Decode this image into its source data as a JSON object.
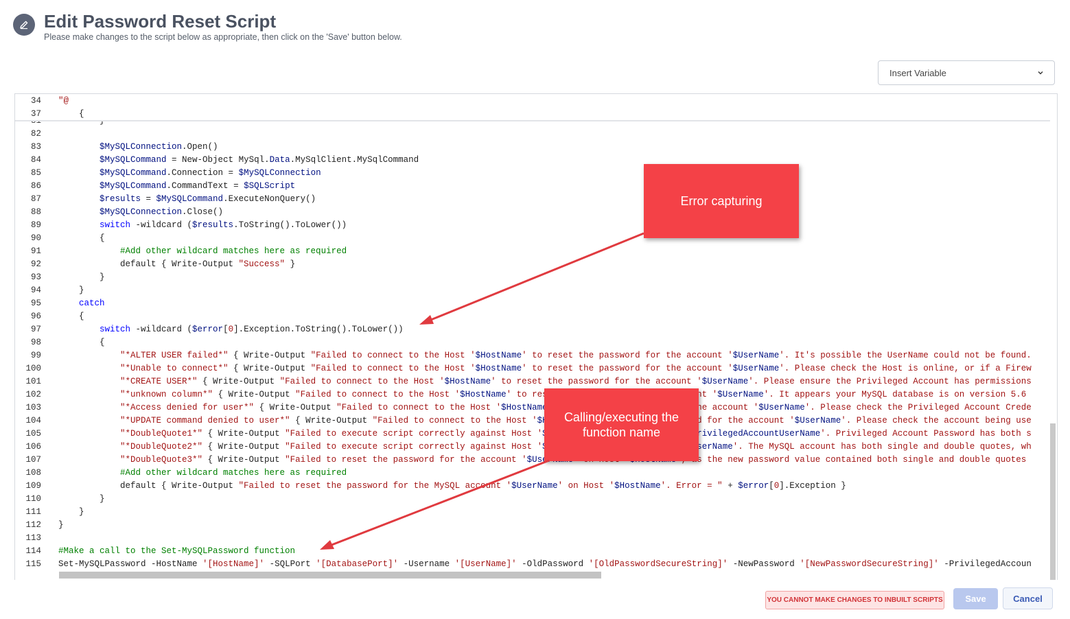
{
  "header": {
    "title": "Edit Password Reset Script",
    "subtitle": "Please make changes to the script below as appropriate, then click on the 'Save' button below.",
    "icon": "pencil-icon"
  },
  "insert_variable": {
    "label": "Insert Variable",
    "icon": "chevron-down-icon"
  },
  "editor": {
    "sticky_lines": [
      {
        "num": "34",
        "html": "<span class=\"s\">\"@</span>"
      },
      {
        "num": "37",
        "html": "    {"
      }
    ],
    "lines": [
      {
        "num": "81",
        "html": "        }"
      },
      {
        "num": "82",
        "html": ""
      },
      {
        "num": "83",
        "html": "        <span class=\"v\">$MySQLConnection</span>.Open()"
      },
      {
        "num": "84",
        "html": "        <span class=\"v\">$MySQLCommand</span> = New-Object MySql.<span class=\"v\">Data</span>.MySqlClient.MySqlCommand"
      },
      {
        "num": "85",
        "html": "        <span class=\"v\">$MySQLCommand</span>.Connection = <span class=\"v\">$MySQLConnection</span>"
      },
      {
        "num": "86",
        "html": "        <span class=\"v\">$MySQLCommand</span>.CommandText = <span class=\"v\">$SQLScript</span>"
      },
      {
        "num": "87",
        "html": "        <span class=\"v\">$results</span> = <span class=\"v\">$MySQLCommand</span>.ExecuteNonQuery()"
      },
      {
        "num": "88",
        "html": "        <span class=\"v\">$MySQLConnection</span>.Close()"
      },
      {
        "num": "89",
        "html": "        <span class=\"k\">switch</span> -wildcard (<span class=\"v\">$results</span>.ToString().ToLower())"
      },
      {
        "num": "90",
        "html": "        {"
      },
      {
        "num": "91",
        "html": "            <span class=\"c\">#Add other wildcard matches here as required</span>"
      },
      {
        "num": "92",
        "html": "            default { Write-Output <span class=\"s\">\"Success\"</span> }"
      },
      {
        "num": "93",
        "html": "        }"
      },
      {
        "num": "94",
        "html": "    }"
      },
      {
        "num": "95",
        "html": "    <span class=\"k\">catch</span>"
      },
      {
        "num": "96",
        "html": "    {"
      },
      {
        "num": "97",
        "html": "        <span class=\"k\">switch</span> -wildcard (<span class=\"v\">$error</span>[<span class=\"s\">0</span>].Exception.ToString().ToLower())"
      },
      {
        "num": "98",
        "html": "        {"
      },
      {
        "num": "99",
        "html": "            <span class=\"s\">\"*ALTER USER failed*\"</span> { Write-Output <span class=\"s\">\"Failed to connect to the Host '</span><span class=\"v\">$HostName</span><span class=\"s\">' to reset the password for the account '</span><span class=\"v\">$UserName</span><span class=\"s\">'. It's possible the UserName could not be found.</span>"
      },
      {
        "num": "100",
        "html": "            <span class=\"s\">\"*Unable to connect*\"</span> { Write-Output <span class=\"s\">\"Failed to connect to the Host '</span><span class=\"v\">$HostName</span><span class=\"s\">' to reset the password for the account '</span><span class=\"v\">$UserName</span><span class=\"s\">'. Please check the Host is online, or if a Firew</span>"
      },
      {
        "num": "101",
        "html": "            <span class=\"s\">\"*CREATE USER*\"</span> { Write-Output <span class=\"s\">\"Failed to connect to the Host '</span><span class=\"v\">$HostName</span><span class=\"s\">' to reset the password for the account '</span><span class=\"v\">$UserName</span><span class=\"s\">'. Please ensure the Privileged Account has permissions</span>"
      },
      {
        "num": "102",
        "html": "            <span class=\"s\">\"*unknown column*\"</span> { Write-Output <span class=\"s\">\"Failed to connect to the Host '</span><span class=\"v\">$HostName</span><span class=\"s\">' to reset the password for the account '</span><span class=\"v\">$UserName</span><span class=\"s\">'. It appears your MySQL database is on version 5.6</span>"
      },
      {
        "num": "103",
        "html": "            <span class=\"s\">\"*Access denied for user*\"</span> { Write-Output <span class=\"s\">\"Failed to connect to the Host '</span><span class=\"v\">$HostName</span><span class=\"s\">' to reset the password for the account '</span><span class=\"v\">$UserName</span><span class=\"s\">'. Please check the Privileged Account Crede</span>"
      },
      {
        "num": "104",
        "html": "            <span class=\"s\">\"*UPDATE command denied to user*\"</span> { Write-Output <span class=\"s\">\"Failed to connect to the Host '</span><span class=\"v\">$HostName</span><span class=\"s\">' to reset the password for the account '</span><span class=\"v\">$UserName</span><span class=\"s\">'. Please check the account being use</span>"
      },
      {
        "num": "105",
        "html": "            <span class=\"s\">\"*DoubleQuote1*\"</span> { Write-Output <span class=\"s\">\"Failed to execute script correctly against Host '</span><span class=\"v\">$HostName</span><span class=\"s\">' for the account '</span><span class=\"v\">$PrivilegedAccountUserName</span><span class=\"s\">'. Privileged Account Password has both s</span>"
      },
      {
        "num": "106",
        "html": "            <span class=\"s\">\"*DoubleQuote2*\"</span> { Write-Output <span class=\"s\">\"Failed to execute script correctly against Host '</span><span class=\"v\">$HostName</span><span class=\"s\">' for the account '</span><span class=\"v\">$UserName</span><span class=\"s\">'. The MySQL account has both single and double quotes, wh</span>"
      },
      {
        "num": "107",
        "html": "            <span class=\"s\">\"*DoubleQuote3*\"</span> { Write-Output <span class=\"s\">\"Failed to reset the password for the account '</span><span class=\"v\">$UserName</span><span class=\"s\">' on Host '</span><span class=\"v\">$HostName</span><span class=\"s\">', as the new password value contained both single and double quotes</span>"
      },
      {
        "num": "108",
        "html": "            <span class=\"c\">#Add other wildcard matches here as required</span>"
      },
      {
        "num": "109",
        "html": "            default { Write-Output <span class=\"s\">\"Failed to reset the password for the MySQL account '</span><span class=\"v\">$UserName</span><span class=\"s\">' on Host '</span><span class=\"v\">$HostName</span><span class=\"s\">'. Error = \"</span> + <span class=\"v\">$error</span>[<span class=\"s\">0</span>].Exception }"
      },
      {
        "num": "110",
        "html": "        }"
      },
      {
        "num": "111",
        "html": "    }"
      },
      {
        "num": "112",
        "html": "}"
      },
      {
        "num": "113",
        "html": ""
      },
      {
        "num": "114",
        "html": "<span class=\"c\">#Make a call to the Set-MySQLPassword function</span>"
      },
      {
        "num": "115",
        "html": "Set-MySQLPassword -HostName <span class=\"s\">'[HostName]'</span> -SQLPort <span class=\"s\">'[DatabasePort]'</span> -Username <span class=\"s\">'[UserName]'</span> -OldPassword <span class=\"s\">'[OldPasswordSecureString]'</span> -NewPassword <span class=\"s\">'[NewPasswordSecureString]'</span> -PrivilegedAccoun"
      }
    ]
  },
  "annotations": {
    "error_capturing": "Error capturing",
    "calling_function": "Calling/executing the function name"
  },
  "footer": {
    "warning": "YOU CANNOT MAKE CHANGES TO INBUILT SCRIPTS",
    "save_label": "Save",
    "cancel_label": "Cancel"
  },
  "colors": {
    "callout": "#f44147",
    "keyword": "#0000ff",
    "variable": "#001080",
    "string": "#a31515",
    "comment": "#008000"
  }
}
